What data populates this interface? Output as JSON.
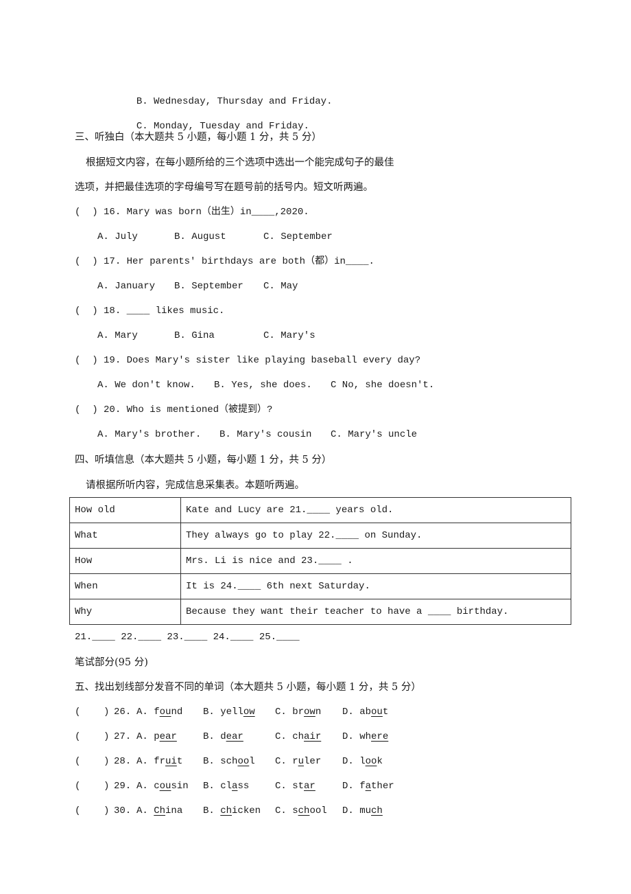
{
  "prev_options": [
    {
      "label": "B.",
      "text": "Wednesday, Thursday and Friday."
    },
    {
      "label": "C.",
      "text": "Monday, Tuesday and Friday."
    }
  ],
  "section3": {
    "heading": "三、听独白（本大题共 5 小题，每小题 1 分，共 5 分）",
    "instruction_line1": "根据短文内容，在每小题所给的三个选项中选出一个能完成句子的最佳",
    "instruction_line2": "选项，并把最佳选项的字母编号写在题号前的括号内。短文听两遍。",
    "questions": [
      {
        "bracket": "(  )",
        "text": "16. Mary was born（出生）in____,2020.",
        "options": [
          "A. July",
          "B. August",
          "C. September"
        ]
      },
      {
        "bracket": "(  )",
        "text": "17. Her parents' birthdays are both（都）in____.",
        "options": [
          "A. January",
          "B. September",
          "C. May"
        ]
      },
      {
        "bracket": "(  )",
        "text": "18. ____ likes music.",
        "options": [
          "A. Mary",
          "B. Gina",
          "C. Mary's"
        ]
      },
      {
        "bracket": "(  )",
        "text": "19. Does Mary's sister like playing baseball every day?",
        "options": [
          "A. We don't know.",
          "B. Yes, she does.",
          "C No, she doesn't."
        ]
      },
      {
        "bracket": "(  )",
        "text": "20. Who is mentioned（被提到）?",
        "options": [
          "A. Mary's brother.",
          "B. Mary's cousin",
          "C. Mary's uncle"
        ]
      }
    ]
  },
  "section4": {
    "heading": "四、听填信息（本大题共 5 小题，每小题 1 分，共 5 分）",
    "instruction": "请根据所听内容，完成信息采集表。本题听两遍。",
    "table": [
      {
        "key": "How old",
        "value": "Kate and Lucy are 21.____ years old."
      },
      {
        "key": "What",
        "value": "They always go to play 22.____ on Sunday."
      },
      {
        "key": "How",
        "value": "Mrs. Li is nice and 23.____ ."
      },
      {
        "key": "When",
        "value": "It is 24.____ 6th next Saturday."
      },
      {
        "key": "Why",
        "value": "Because they want their teacher to have a ____ birthday."
      }
    ],
    "answer_line": "21.____ 22.____ 23.____ 24.____ 25.____"
  },
  "written_part": {
    "heading": "笔试部分(95 分)"
  },
  "section5": {
    "heading": "五、找出划线部分发音不同的单词（本大题共 5 小题，每小题 1 分，共 5 分）",
    "questions": [
      {
        "bracket": "(    )",
        "num": "26.",
        "options": [
          {
            "label": "A.",
            "pre": "f",
            "u": "ou",
            "post": "nd"
          },
          {
            "label": "B.",
            "pre": "yell",
            "u": "ow",
            "post": ""
          },
          {
            "label": "C.",
            "pre": "br",
            "u": "ow",
            "post": "n"
          },
          {
            "label": "D.",
            "pre": "ab",
            "u": "ou",
            "post": "t"
          }
        ]
      },
      {
        "bracket": "(    )",
        "num": "27.",
        "options": [
          {
            "label": "A.",
            "pre": "p",
            "u": "ear",
            "post": ""
          },
          {
            "label": "B.",
            "pre": "d",
            "u": "ear",
            "post": ""
          },
          {
            "label": "C.",
            "pre": "ch",
            "u": "air",
            "post": ""
          },
          {
            "label": "D.",
            "pre": "wh",
            "u": "ere",
            "post": ""
          }
        ]
      },
      {
        "bracket": "(    )",
        "num": "28.",
        "options": [
          {
            "label": "A.",
            "pre": "fr",
            "u": "ui",
            "post": "t"
          },
          {
            "label": "B.",
            "pre": "sch",
            "u": "oo",
            "post": "l"
          },
          {
            "label": "C.",
            "pre": "r",
            "u": "u",
            "post": "ler"
          },
          {
            "label": "D.",
            "pre": "l",
            "u": "oo",
            "post": "k"
          }
        ]
      },
      {
        "bracket": "(    )",
        "num": "29.",
        "options": [
          {
            "label": "A.",
            "pre": "c",
            "u": "ou",
            "post": "sin"
          },
          {
            "label": "B.",
            "pre": "cl",
            "u": "a",
            "post": "ss"
          },
          {
            "label": "C.",
            "pre": "st",
            "u": "ar",
            "post": ""
          },
          {
            "label": "D.",
            "pre": "f",
            "u": "a",
            "post": "ther"
          }
        ]
      },
      {
        "bracket": "(    )",
        "num": "30.",
        "options": [
          {
            "label": "A.",
            "pre": "",
            "u": "Ch",
            "post": "ina"
          },
          {
            "label": "B.",
            "pre": "",
            "u": "ch",
            "post": "icken"
          },
          {
            "label": "C.",
            "pre": "s",
            "u": "ch",
            "post": "ool"
          },
          {
            "label": "D.",
            "pre": "mu",
            "u": "ch",
            "post": ""
          }
        ]
      }
    ]
  }
}
